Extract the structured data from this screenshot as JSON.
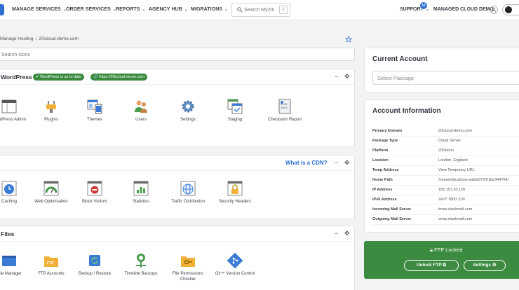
{
  "nav": {
    "items": [
      "MANAGE SERVICES",
      "ORDER SERVICES",
      "REPORTS",
      "AGENCY HUB",
      "MIGRATIONS"
    ],
    "search_placeholder": "Search My20i",
    "search_shortcut": "/",
    "support_label": "SUPPORT",
    "support_badge": "12",
    "account_label": "MANAGED CLOUD DEMO"
  },
  "breadcrumb": {
    "parent": "Manage Hosting",
    "separator": "/",
    "current": "20icloud-demo.com"
  },
  "icon_search": {
    "placeholder": "Search Icons"
  },
  "panels": {
    "wordpress": {
      "title": "WordPress Tools",
      "badge_status": "WordPress is up to date",
      "badge_url": "https://20icloud-demo.com",
      "tools": [
        "WordPress Admin",
        "Plugins",
        "Themes",
        "Users",
        "Settings",
        "Staging",
        "Checksum Report"
      ]
    },
    "cdn": {
      "link": "What is a CDN?",
      "tools": [
        "Caching",
        "Web Optimisation",
        "Block Visitors",
        "Statistics",
        "Traffic Distribution",
        "Security Headers"
      ]
    },
    "files": {
      "title": "Files",
      "tools": [
        "File Manager",
        "FTP Accounts",
        "Backup / Restore",
        "Timeline Backups",
        "File Permissions Checker",
        "Git™ Version Control"
      ]
    }
  },
  "current_account": {
    "title": "Current Account",
    "select_placeholder": "Select Package"
  },
  "account_info": {
    "title": "Account Information",
    "rows": [
      {
        "label": "Primary Domain",
        "value": "20icloud-demo.com"
      },
      {
        "label": "Package Type",
        "value": "Cloud Server"
      },
      {
        "label": "Platform",
        "value": "20iDemo"
      },
      {
        "label": "Location",
        "value": "London, England"
      },
      {
        "label": "Temp Address",
        "value": "View Temporary URL"
      },
      {
        "label": "Home Path",
        "value": "/home/virtual/vps-ea5af375/51be344764/"
      },
      {
        "label": "IP Address",
        "value": "185.151.30.126"
      },
      {
        "label": "IPv6 Address",
        "value": "2a07:7800::126"
      },
      {
        "label": "Incoming Mail Server",
        "value": "imap.stackmail.com"
      },
      {
        "label": "Outgoing Mail Server",
        "value": "smtp.stackmail.com"
      }
    ]
  },
  "ftp": {
    "title": "FTP Locked",
    "unlock_label": "Unlock FTP",
    "settings_label": "Settings"
  },
  "colors": {
    "brand_blue": "#2f6fd1",
    "success_green": "#3d8b40",
    "badge_green": "#3a8a3e"
  }
}
